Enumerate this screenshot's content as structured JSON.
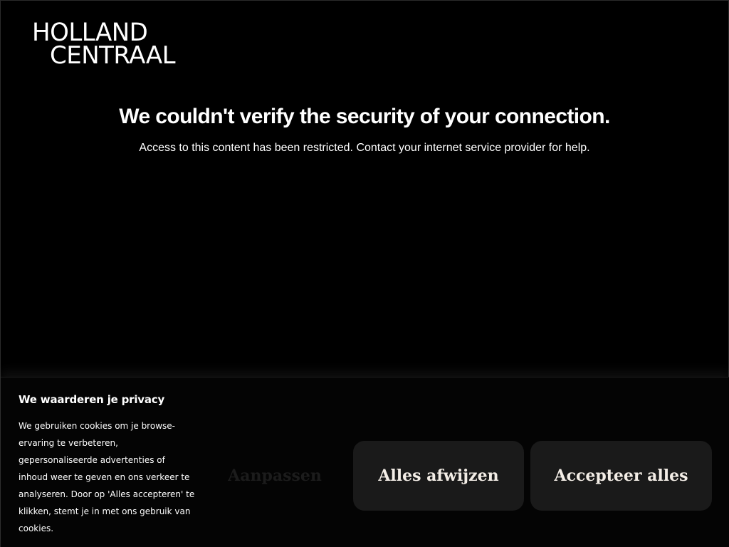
{
  "logo": {
    "line1": "HOLLAND",
    "line2": "CENTRAAL"
  },
  "error": {
    "heading": "We couldn't verify the security of your connection.",
    "message": "Access to this content has been restricted. Contact your internet service provider for help."
  },
  "cookie_banner": {
    "title": "We waarderen je privacy",
    "body": "We gebruiken cookies om je browse-ervaring te verbeteren, gepersonaliseerde advertenties of inhoud weer te geven en ons verkeer te analyseren. Door op 'Alles accepteren' te klikken, stemt je in met ons gebruik van cookies.",
    "customize_label": "Aanpassen",
    "reject_label": "Alles afwijzen",
    "accept_label": "Accepteer alles"
  },
  "colors": {
    "background": "#000000",
    "text": "#ffffff",
    "button_bg": "#1a1a1a",
    "button_text": "#f3ede6"
  }
}
